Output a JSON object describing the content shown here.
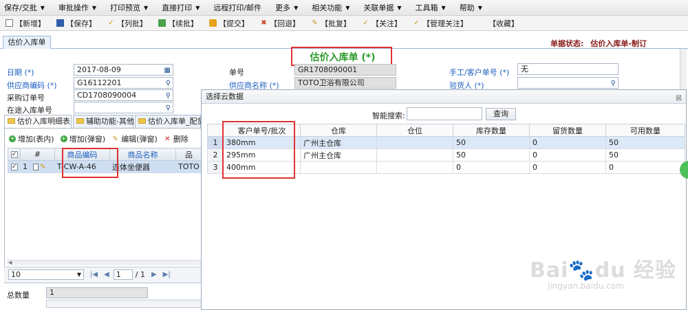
{
  "menubar": {
    "items": [
      "保存/交批",
      "审批操作",
      "打印预览",
      "直接打印",
      "远程打印/邮件",
      "更多",
      "相关功能",
      "关联单据",
      "工具箱",
      "帮助"
    ]
  },
  "toolbar": {
    "buttons": [
      {
        "label": "【新增】",
        "icon": "new-doc-icon"
      },
      {
        "label": "【保存】",
        "icon": "save-icon"
      },
      {
        "label": "【列批】",
        "icon": "check-icon"
      },
      {
        "label": "【续批】",
        "icon": "copy-icon"
      },
      {
        "label": "【提交】",
        "icon": "submit-icon"
      },
      {
        "label": "【回退】",
        "icon": "undo-x-icon"
      },
      {
        "label": "【批复】",
        "icon": "edit-icon"
      },
      {
        "label": "【关注】",
        "icon": "check-icon"
      },
      {
        "label": "【管理关注】",
        "icon": "check-icon"
      },
      {
        "label": "【收藏】",
        "icon": "star-icon"
      }
    ]
  },
  "doc_tab": "估价入库单",
  "status": {
    "label": "单据状态:",
    "value": "估价入库单-制订"
  },
  "form": {
    "title": "估价入库单 (*)",
    "date_label": "日期 (*)",
    "date_value": "2017-08-09",
    "no_label": "单号",
    "no_value": "GR1708090001",
    "manual_no_label": "手工/客户单号 (*)",
    "manual_no_value": "无",
    "supplier_code_label": "供应商编码 (*)",
    "supplier_code_value": "G16112201",
    "supplier_name_label": "供应商名称 (*)",
    "supplier_name_value": "TOTO卫浴有限公司",
    "inspector_label": "验货人 (*)",
    "inspector_value": "",
    "po_label": "采购订单号",
    "po_value": "CD1708090004",
    "transit_label": "在途入库单号",
    "transit_value": ""
  },
  "subtabs": [
    "估价入库明细表",
    "辅助功能-其他",
    "估价入库单_配货"
  ],
  "left_toolbar": {
    "add_inline": "增加(表内)",
    "add_popup": "增加(弹窗)",
    "edit_popup": "编辑(弹窗)",
    "delete": "删除"
  },
  "left_grid": {
    "headers": [
      "",
      "#",
      "商品编码",
      "商品名称",
      "品"
    ],
    "rows": [
      {
        "num": "1",
        "code": "T-CW-A-46",
        "name": "连体坐便器",
        "extra": "TOTO"
      }
    ]
  },
  "pager": {
    "page_size": "10",
    "page": "1",
    "total": "/ 1"
  },
  "bottom": {
    "total_qty_label": "总数量",
    "total_qty_value": "1"
  },
  "dialog": {
    "title": "选择云数据",
    "close": "☒",
    "search_label": "智能搜索:",
    "search_value": "",
    "query_button": "查询",
    "headers": [
      "",
      "客户单号/批次",
      "仓库",
      "仓位",
      "库存数量",
      "留货数量",
      "可用数量"
    ],
    "rows": [
      {
        "n": "1",
        "batch": "380mm",
        "warehouse": "广州主仓库",
        "bin": "",
        "stock": "50",
        "reserved": "0",
        "available": "50"
      },
      {
        "n": "2",
        "batch": "295mm",
        "warehouse": "广州主仓库",
        "bin": "",
        "stock": "50",
        "reserved": "0",
        "available": "50"
      },
      {
        "n": "3",
        "batch": "400mm",
        "warehouse": "",
        "bin": "",
        "stock": "0",
        "reserved": "0",
        "available": "0"
      }
    ]
  },
  "watermark": {
    "main": "Bai🐾du 经验",
    "sub": "jingyan.baidu.com"
  },
  "colors": {
    "title_green": "#2a9a2a",
    "highlight_red": "#e03030",
    "label_blue": "#1a5fc0",
    "status_red": "#8a1a1a"
  }
}
